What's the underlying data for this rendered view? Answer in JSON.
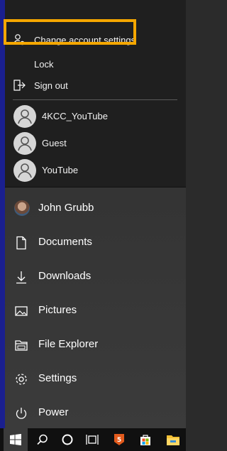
{
  "flyout": {
    "items": [
      {
        "label": "Change account settings",
        "icon": "person-gear-icon"
      },
      {
        "label": "Lock",
        "icon": "lock-icon"
      },
      {
        "label": "Sign out",
        "icon": "sign-out-icon"
      }
    ],
    "users": [
      {
        "label": "4KCC_YouTube"
      },
      {
        "label": "Guest"
      },
      {
        "label": "YouTube"
      }
    ]
  },
  "menu": {
    "user": {
      "label": "John Grubb"
    },
    "items": [
      {
        "label": "Documents",
        "icon": "document-icon"
      },
      {
        "label": "Downloads",
        "icon": "download-icon"
      },
      {
        "label": "Pictures",
        "icon": "pictures-icon"
      },
      {
        "label": "File Explorer",
        "icon": "folder-icon"
      },
      {
        "label": "Settings",
        "icon": "gear-icon"
      },
      {
        "label": "Power",
        "icon": "power-icon"
      }
    ]
  },
  "taskbar": {
    "items": [
      "windows-start-icon",
      "search-icon",
      "cortana-icon",
      "task-view-icon",
      "app-icon",
      "store-icon",
      "file-explorer-icon"
    ]
  },
  "colors": {
    "highlight": "#f5a700",
    "flyout_bg": "#1f1f1f",
    "menu_bg": "#383838",
    "taskbar_bg": "#101010"
  }
}
